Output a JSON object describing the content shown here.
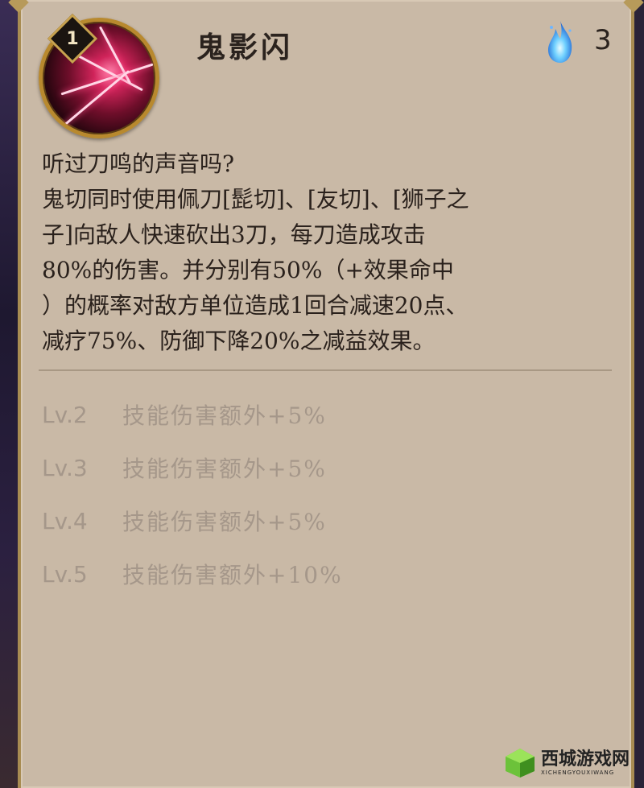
{
  "skill": {
    "level": "1",
    "name": "鬼影闪",
    "cost": "3",
    "cost_icon": "blue-flame-icon",
    "icon": "slash-skill-icon"
  },
  "description": {
    "question": "听过刀鸣的声音吗?",
    "lines": [
      "鬼切同时使用佩刀[髭切]、[友切]、[狮子之",
      "子]向敌人快速砍出3刀，每刀造成攻击",
      "80%的伤害。并分别有50%（+效果命中",
      "）的概率对敌方单位造成1回合减速20点、",
      "减疗75%、防御下降20%之减益效果。"
    ]
  },
  "upgrades": [
    {
      "level": "Lv.2",
      "text": "技能伤害额外+5%"
    },
    {
      "level": "Lv.3",
      "text": "技能伤害额外+5%"
    },
    {
      "level": "Lv.4",
      "text": "技能伤害额外+5%"
    },
    {
      "level": "Lv.5",
      "text": "技能伤害额外+10%"
    }
  ],
  "watermark": {
    "main": "西城游戏网",
    "sub": "XICHENGYOUXIWANG"
  },
  "colors": {
    "panel": "#c9b9a6",
    "border_gold": "#a88c52",
    "text_dark": "#2a211c",
    "text_muted": "#a5978a"
  }
}
